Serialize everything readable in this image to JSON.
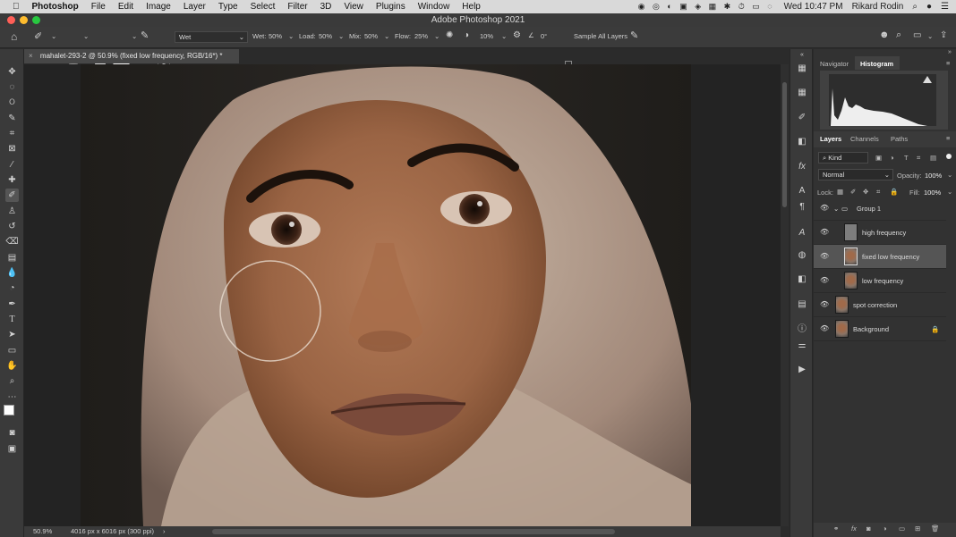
{
  "menubar": {
    "apple": "",
    "items": [
      "Photoshop",
      "File",
      "Edit",
      "Image",
      "Layer",
      "Type",
      "Select",
      "Filter",
      "3D",
      "View",
      "Plugins",
      "Window",
      "Help"
    ],
    "datetime": "Wed 10:47 PM",
    "user": "Rikard Rodin"
  },
  "window": {
    "title": "Adobe Photoshop 2021"
  },
  "options": {
    "brush_size": "570",
    "mode_value": "Wet",
    "wet_label": "Wet:",
    "wet_value": "50%",
    "load_label": "Load:",
    "load_value": "50%",
    "mix_label": "Mix:",
    "mix_value": "50%",
    "flow_label": "Flow:",
    "flow_value": "25%",
    "smoothing_value": "10%",
    "angle_value": "0°",
    "sample_all_label": "Sample All Layers"
  },
  "document": {
    "tab_title": "mahalet-293-2 @ 50.9% (fixed low frequency, RGB/16*) *"
  },
  "status": {
    "zoom": "50.9%",
    "doc_size": "4016 px x 6016 px (300 ppi)"
  },
  "panels": {
    "top_tabs": [
      "Navigator",
      "Histogram"
    ],
    "layer_tabs": [
      "Layers",
      "Channels",
      "Paths"
    ],
    "kind_label": "Kind",
    "blend_mode": "Normal",
    "opacity_label": "Opacity:",
    "opacity_value": "100%",
    "lock_label": "Lock:",
    "fill_label": "Fill:",
    "fill_value": "100%"
  },
  "layers": [
    {
      "name": "Group 1"
    },
    {
      "name": "high frequency"
    },
    {
      "name": "fixed low frequency"
    },
    {
      "name": "low frequency"
    },
    {
      "name": "spot correction"
    },
    {
      "name": "Background"
    }
  ],
  "colors": {
    "accent_selected_layer": "#555555",
    "menubar_bg": "#d9d9d9",
    "ui_dark": "#323232"
  }
}
